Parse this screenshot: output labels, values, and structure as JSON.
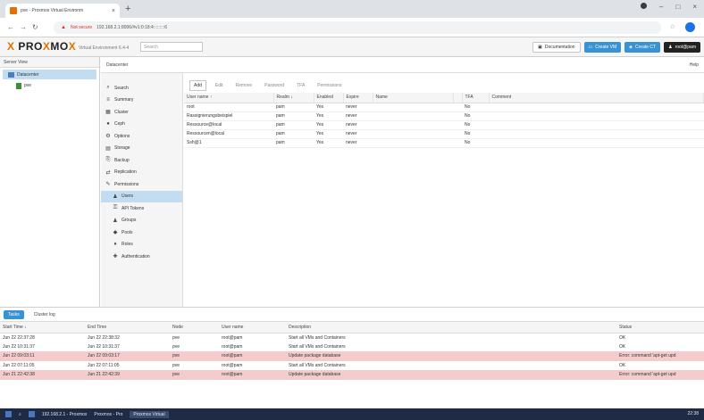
{
  "browser": {
    "tab_title": "pve - Proxmox Virtual Environm",
    "new_tab": "+",
    "security": "Not secure",
    "url": "192.168.2.1:8006/#v1:0:18:4:::::::::6",
    "win_min": "–",
    "win_max": "□",
    "win_close": "×"
  },
  "header": {
    "logo_a": "PRO",
    "logo_b": "X",
    "logo_c": "MO",
    "logo_d": "X",
    "version": "Virtual Environment 6.4-4",
    "search_placeholder": "Search",
    "doc_label": "Documentation",
    "create_vm": "Create VM",
    "create_ct": "Create CT",
    "user": "root@pam"
  },
  "tree": {
    "view": "Server View",
    "datacenter": "Datacenter",
    "node": "pve"
  },
  "content": {
    "title": "Datacenter",
    "help": "Help"
  },
  "menu": [
    {
      "label": "Search",
      "glyph": "⌕"
    },
    {
      "label": "Summary",
      "glyph": "≡"
    },
    {
      "label": "Cluster",
      "glyph": "▦"
    },
    {
      "label": "Ceph",
      "glyph": "●"
    },
    {
      "label": "Options",
      "glyph": "⚙"
    },
    {
      "label": "Storage",
      "glyph": "▤"
    },
    {
      "label": "Backup",
      "glyph": "⎘"
    },
    {
      "label": "Replication",
      "glyph": "⇄"
    },
    {
      "label": "Permissions",
      "glyph": "✎"
    },
    {
      "label": "Users",
      "glyph": "♟"
    },
    {
      "label": "API Tokens",
      "glyph": "⚿"
    },
    {
      "label": "Groups",
      "glyph": "♟"
    },
    {
      "label": "Pools",
      "glyph": "◆"
    },
    {
      "label": "Roles",
      "glyph": "♦"
    },
    {
      "label": "Authentication",
      "glyph": "✚"
    }
  ],
  "users_toolbar": [
    "Add",
    "Edit",
    "Remove",
    "Password",
    "TFA",
    "Permissions"
  ],
  "users_columns": [
    "User name ↑",
    "Realm ↓",
    "Enabled",
    "Expire",
    "Name",
    "",
    "TFA",
    "Comment"
  ],
  "users": [
    {
      "user": "root",
      "realm": "pam",
      "enabled": "Yes",
      "expire": "never",
      "tfa": "No"
    },
    {
      "user": "Rassignierungsbeispiel",
      "realm": "pam",
      "enabled": "Yes",
      "expire": "never",
      "tfa": "No"
    },
    {
      "user": "Ressource@local",
      "realm": "pam",
      "enabled": "Yes",
      "expire": "never",
      "tfa": "No"
    },
    {
      "user": "Ressourcen@local",
      "realm": "pam",
      "enabled": "Yes",
      "expire": "never",
      "tfa": "No"
    },
    {
      "user": "Ssh@1",
      "realm": "pam",
      "enabled": "Yes",
      "expire": "never",
      "tfa": "No"
    }
  ],
  "tasks": {
    "tab_tasks": "Tasks",
    "tab_cluster": "Cluster log",
    "columns": [
      "Start Time ↓",
      "End Time",
      "Node",
      "User name",
      "Description",
      "Status"
    ],
    "rows": [
      {
        "start": "Jun 22 22:37:28",
        "end": "Jun 22 22:38:32",
        "node": "pve",
        "user": "root@pam",
        "desc": "Start all VMs and Containers",
        "status": "OK",
        "err": false
      },
      {
        "start": "Jun 22 10:31:37",
        "end": "Jun 22 10:31:37",
        "node": "pve",
        "user": "root@pam",
        "desc": "Start all VMs and Containers",
        "status": "OK",
        "err": false
      },
      {
        "start": "Jun 22 09:03:11",
        "end": "Jun 22 09:03:17",
        "node": "pve",
        "user": "root@pam",
        "desc": "Update package database",
        "status": "Error: command 'apt-get upd",
        "err": true
      },
      {
        "start": "Jun 22 07:11:05",
        "end": "Jun 22 07:11:05",
        "node": "pve",
        "user": "root@pam",
        "desc": "Start all VMs and Containers",
        "status": "OK",
        "err": false
      },
      {
        "start": "Jun 21 22:42:38",
        "end": "Jun 21 22:42:39",
        "node": "pve",
        "user": "root@pam",
        "desc": "Update package database",
        "status": "Error: command 'apt-get upd",
        "err": true
      }
    ]
  },
  "taskbar": {
    "item1": "192.168.2.1 - Proxmox",
    "item2": "Proxmox - Pro",
    "item3": "Proxmox Virtual",
    "time": "22:38"
  }
}
